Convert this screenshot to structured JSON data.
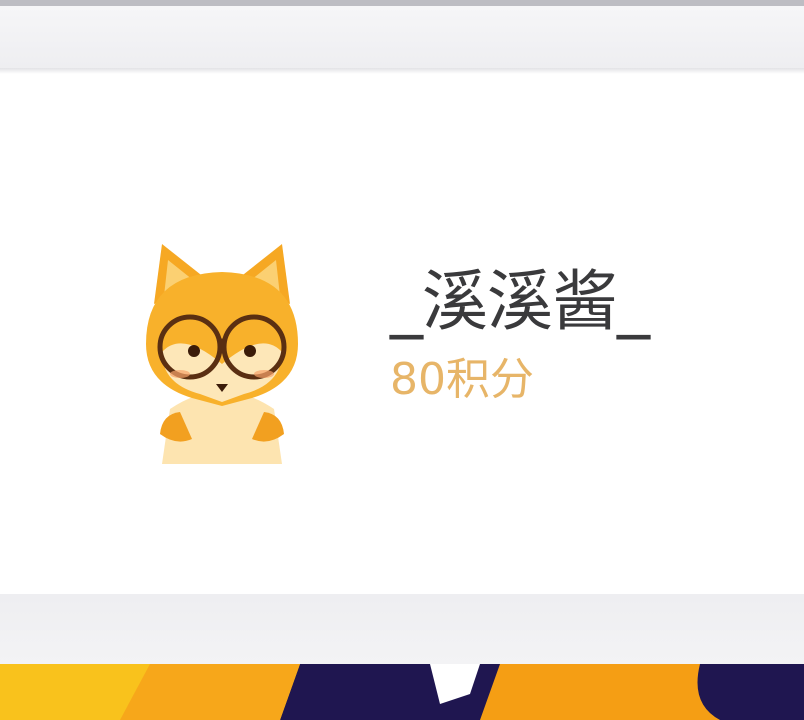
{
  "user": {
    "username": "_溪溪酱_",
    "points_text": "80积分",
    "avatar_icon": "fox-with-glasses-icon"
  },
  "banner": {
    "colors": {
      "yellow": "#f9c21c",
      "orange": "#f59e14",
      "navy": "#1f1650"
    }
  },
  "colors": {
    "username": "#3a3a3c",
    "points": "#e7b568",
    "background": "#ffffff"
  }
}
